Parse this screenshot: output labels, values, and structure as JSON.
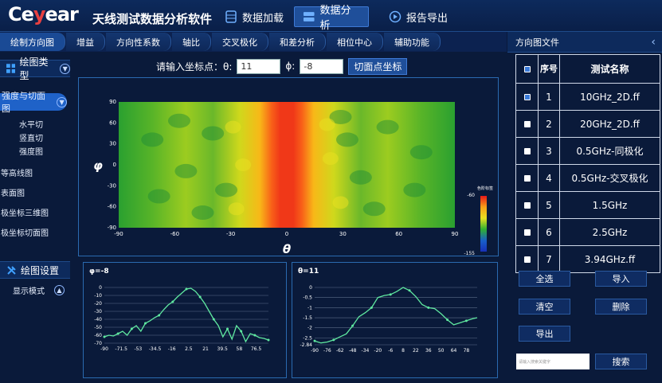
{
  "header": {
    "logo_main": "Ce",
    "logo_accent": "y",
    "logo_end": "ear",
    "title": "天线测试数据分析软件",
    "nav": [
      {
        "label": "数据加载",
        "active": false
      },
      {
        "label": "数据分析",
        "active": true
      },
      {
        "label": "报告导出",
        "active": false
      }
    ]
  },
  "toolbar": {
    "items": [
      "绘制方向图",
      "增益",
      "方向性系数",
      "轴比",
      "交叉极化",
      "和差分析",
      "相位中心",
      "辅助功能"
    ]
  },
  "sidebar": {
    "plot_type": "绘图类型",
    "selected": "强度与切面图",
    "sub_items": [
      "水平切",
      "竖直切",
      "强度图"
    ],
    "items": [
      "等高线图",
      "表面图",
      "极坐标三维图",
      "极坐标切面图"
    ],
    "settings": "绘图设置",
    "display_mode": "显示模式"
  },
  "coord": {
    "prompt": "请输入坐标点：θ:",
    "theta": "11",
    "phi_label": "ϕ:",
    "phi": "-8",
    "button": "切面点坐标"
  },
  "heatmap": {
    "ylabel": "φ",
    "xlabel": "θ",
    "x_ticks": [
      "-90",
      "-60",
      "-30",
      "0",
      "30",
      "60",
      "90"
    ],
    "y_ticks": [
      "90",
      "60",
      "30",
      "0",
      "-30",
      "-60",
      "-90"
    ],
    "colorbar_title": "色阶标签",
    "colorbar_max": "-60",
    "colorbar_min": "-155"
  },
  "chart_data": [
    {
      "type": "line",
      "title": "φ=-8",
      "x_ticks": [
        "-90",
        "-71.5",
        "-53",
        "-34.5",
        "-16",
        "2.5",
        "21",
        "39.5",
        "58",
        "76.5"
      ],
      "y_ticks": [
        "0",
        "-10",
        "-20",
        "-30",
        "-40",
        "-50",
        "-60",
        "-70"
      ],
      "ylim": [
        -70,
        0
      ],
      "xlim": [
        -90,
        90
      ],
      "x": [
        -90,
        -85,
        -80,
        -75,
        -70,
        -65,
        -60,
        -55,
        -50,
        -45,
        -40,
        -35,
        -30,
        -25,
        -20,
        -15,
        -10,
        -5,
        0,
        5,
        10,
        15,
        20,
        25,
        30,
        35,
        40,
        45,
        50,
        55,
        60,
        65,
        70,
        75,
        80,
        85,
        90
      ],
      "values": [
        -62,
        -60,
        -61,
        -58,
        -55,
        -60,
        -52,
        -48,
        -55,
        -45,
        -42,
        -38,
        -35,
        -28,
        -22,
        -18,
        -12,
        -7,
        -2,
        -1,
        -5,
        -12,
        -20,
        -30,
        -40,
        -48,
        -62,
        -52,
        -65,
        -48,
        -55,
        -68,
        -58,
        -60,
        -63,
        -64,
        -66
      ]
    },
    {
      "type": "line",
      "title": "θ=11",
      "x_ticks": [
        "-90",
        "-76",
        "-62",
        "-48",
        "-34",
        "-20",
        "-6",
        "8",
        "22",
        "36",
        "50",
        "64",
        "78"
      ],
      "y_ticks": [
        "0",
        "-0.5",
        "-1",
        "-1.5",
        "-2",
        "-2.5",
        "-2.84"
      ],
      "ylim": [
        -2.84,
        0
      ],
      "xlim": [
        -90,
        90
      ],
      "x": [
        -90,
        -83,
        -76,
        -69,
        -62,
        -55,
        -48,
        -41,
        -34,
        -27,
        -20,
        -13,
        -6,
        1,
        8,
        15,
        22,
        29,
        36,
        43,
        50,
        57,
        64,
        71,
        78,
        85,
        90
      ],
      "values": [
        -2.65,
        -2.75,
        -2.7,
        -2.6,
        -2.45,
        -2.3,
        -1.9,
        -1.45,
        -1.25,
        -1.0,
        -0.5,
        -0.4,
        -0.35,
        -0.2,
        0,
        -0.15,
        -0.45,
        -0.85,
        -1.0,
        -1.05,
        -1.3,
        -1.6,
        -1.85,
        -1.75,
        -1.65,
        -1.55,
        -1.5
      ]
    }
  ],
  "right_panel": {
    "title": "方向图文件",
    "columns": [
      "序号",
      "测试名称"
    ],
    "rows": [
      {
        "no": "1",
        "name": "10GHz_2D.ff",
        "checked": true
      },
      {
        "no": "2",
        "name": "20GHz_2D.ff",
        "checked": false
      },
      {
        "no": "3",
        "name": "0.5GHz-同极化",
        "checked": false
      },
      {
        "no": "4",
        "name": "0.5GHz-交叉极化",
        "checked": false
      },
      {
        "no": "5",
        "name": "1.5GHz",
        "checked": false
      },
      {
        "no": "6",
        "name": "2.5GHz",
        "checked": false
      },
      {
        "no": "7",
        "name": "3.94GHz.ff",
        "checked": false
      }
    ],
    "buttons": {
      "select_all": "全选",
      "import": "导入",
      "clear": "清空",
      "delete": "删除",
      "export": "导出",
      "search": "搜索"
    },
    "search_placeholder": "请输入搜索关键字"
  },
  "colors": {
    "accent": "#1f62c8",
    "background": "#0a1a3a",
    "line": "#5fe8a0"
  }
}
